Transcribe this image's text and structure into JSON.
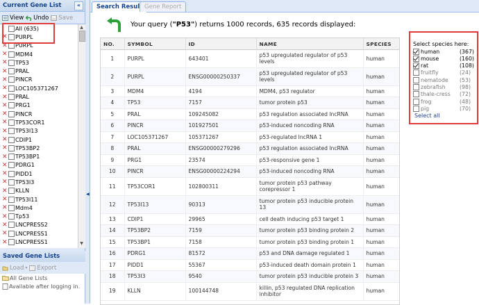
{
  "left_panel": {
    "title": "Current Gene List",
    "collapse_glyph": "«",
    "toolbar": {
      "view": "View",
      "undo": "Undo",
      "save": "Save"
    },
    "genes": [
      "All (635)",
      "PURPL",
      "PURPL",
      "MDM4",
      "TP53",
      "PRAL",
      "PINCR",
      "LOC105371267",
      "PRAL",
      "PRG1",
      "PINCR",
      "TP53COR1",
      "TP53I13",
      "CDIP1",
      "TP53BP2",
      "TP53BP1",
      "PDRG1",
      "PIDD1",
      "TP53I3",
      "KLLN",
      "TP53I11",
      "Mdm4",
      "Tp53",
      "LNCPRESS2",
      "LNCPRESS1",
      "LNCPRESS1"
    ]
  },
  "saved_panel": {
    "title": "Saved Gene Lists",
    "toolbar": {
      "load": "Load",
      "export": "Export"
    },
    "items": [
      "All Gene Lists",
      "Available after logging in."
    ]
  },
  "tabs": {
    "active": "Search Result",
    "inactive": "Gene Report"
  },
  "query_msg": {
    "prefix": "Your query (",
    "query": "\"P53\"",
    "suffix": ") returns 1000 records, 635 records displayed:"
  },
  "table": {
    "headers": [
      "NO.",
      "SYMBOL",
      "ID",
      "NAME",
      "SPECIES"
    ],
    "rows": [
      [
        "1",
        "PURPL",
        "643401",
        "p53 upregulated regulator of p53 levels",
        "human"
      ],
      [
        "2",
        "PURPL",
        "ENSG00000250337",
        "p53 upregulated regulator of p53 levels",
        "human"
      ],
      [
        "3",
        "MDM4",
        "4194",
        "MDM4, p53 regulator",
        "human"
      ],
      [
        "4",
        "TP53",
        "7157",
        "tumor protein p53",
        "human"
      ],
      [
        "5",
        "PRAL",
        "109245082",
        "p53 regulation associated lncRNA",
        "human"
      ],
      [
        "6",
        "PINCR",
        "101927501",
        "p53-induced noncoding RNA",
        "human"
      ],
      [
        "7",
        "LOC105371267",
        "105371267",
        "p53-regulated lncRNA 1",
        "human"
      ],
      [
        "8",
        "PRAL",
        "ENSG00000279296",
        "p53 regulation associated lncRNA",
        "human"
      ],
      [
        "9",
        "PRG1",
        "23574",
        "p53-responsive gene 1",
        "human"
      ],
      [
        "10",
        "PINCR",
        "ENSG00000224294",
        "p53-induced noncoding RNA",
        "human"
      ],
      [
        "11",
        "TP53COR1",
        "102800311",
        "tumor protein p53 pathway corepressor 1",
        "human"
      ],
      [
        "12",
        "TP53I13",
        "90313",
        "tumor protein p53 inducible protein 13",
        "human"
      ],
      [
        "13",
        "CDIP1",
        "29965",
        "cell death inducing p53 target 1",
        "human"
      ],
      [
        "14",
        "TP53BP2",
        "7159",
        "tumor protein p53 binding protein 2",
        "human"
      ],
      [
        "15",
        "TP53BP1",
        "7158",
        "tumor protein p53 binding protein 1",
        "human"
      ],
      [
        "16",
        "PDRG1",
        "81572",
        "p53 and DNA damage regulated 1",
        "human"
      ],
      [
        "17",
        "PIDD1",
        "55367",
        "p53-induced death domain protein 1",
        "human"
      ],
      [
        "18",
        "TP53I3",
        "9540",
        "tumor protein p53 inducible protein 3",
        "human"
      ],
      [
        "19",
        "KLLN",
        "100144748",
        "killin, p53 regulated DNA replication inhibitor",
        "human"
      ]
    ]
  },
  "species_filter": {
    "title": "Select species here:",
    "options": [
      {
        "name": "human",
        "count": "(367)",
        "checked": true
      },
      {
        "name": "mouse",
        "count": "(160)",
        "checked": true
      },
      {
        "name": "rat",
        "count": "(108)",
        "checked": true
      },
      {
        "name": "fruitfly",
        "count": "(24)",
        "checked": false
      },
      {
        "name": "nematode",
        "count": "(53)",
        "checked": false
      },
      {
        "name": "zebrafish",
        "count": "(98)",
        "checked": false
      },
      {
        "name": "thale-cress",
        "count": "(72)",
        "checked": false
      },
      {
        "name": "frog",
        "count": "(48)",
        "checked": false
      },
      {
        "name": "pig",
        "count": "(70)",
        "checked": false
      }
    ],
    "select_all": "Select all"
  },
  "colors": {
    "accent": "#15428b",
    "highlight": "#e03a3a",
    "back_arrow": "#2e9e3a"
  }
}
